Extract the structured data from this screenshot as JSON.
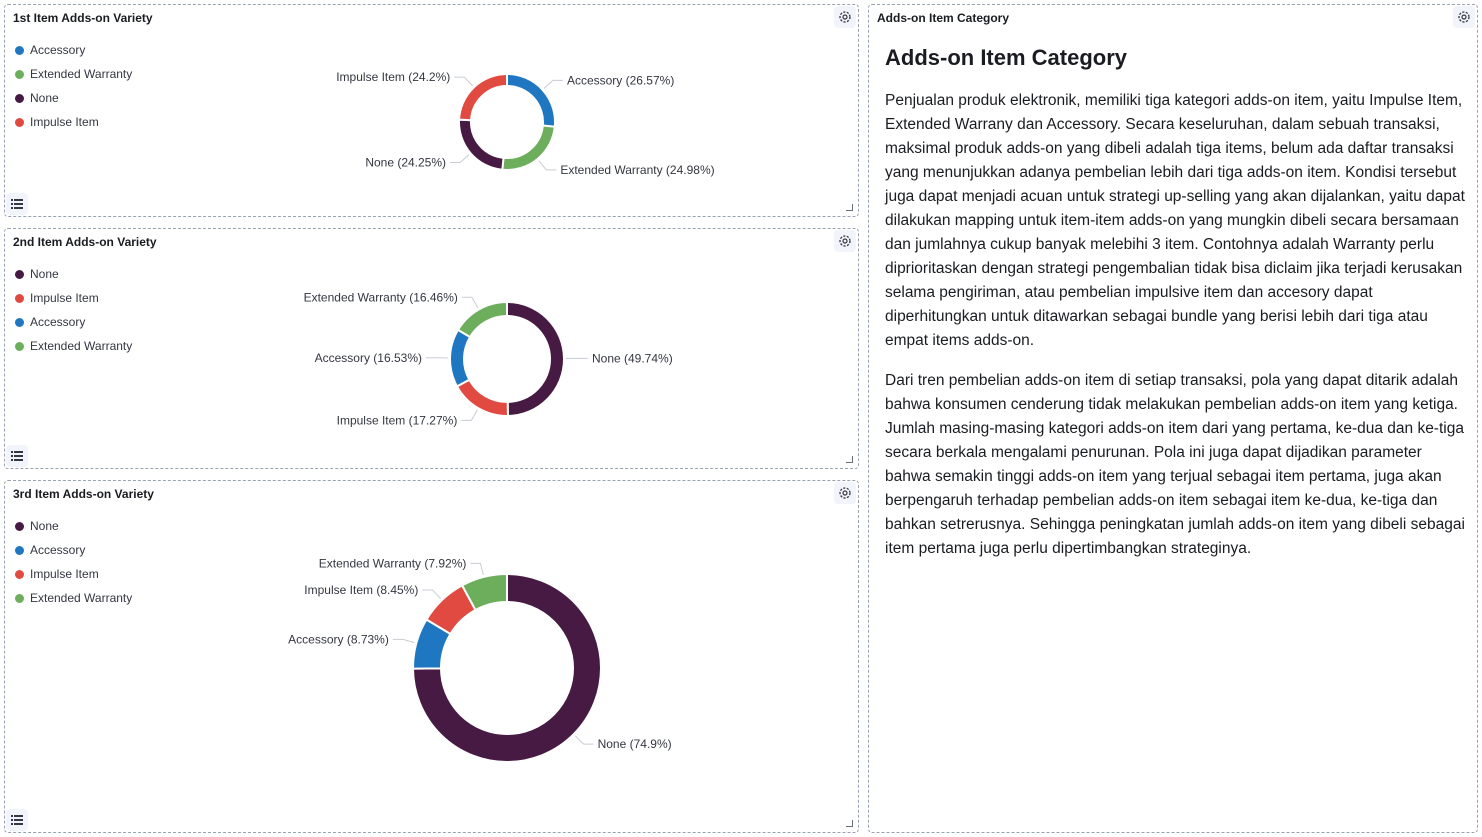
{
  "colors": {
    "Accessory": "#1f77c2",
    "Extended Warranty": "#6dae5d",
    "None": "#461a42",
    "Impulse Item": "#e04a41"
  },
  "panels": [
    {
      "title": "1st Item Adds-on Variety",
      "legend": [
        "Accessory",
        "Extended Warranty",
        "None",
        "Impulse Item"
      ]
    },
    {
      "title": "2nd Item Adds-on Variety",
      "legend": [
        "None",
        "Impulse Item",
        "Accessory",
        "Extended Warranty"
      ]
    },
    {
      "title": "3rd Item Adds-on Variety",
      "legend": [
        "None",
        "Accessory",
        "Impulse Item",
        "Extended Warranty"
      ]
    }
  ],
  "chart_data": [
    {
      "type": "pie",
      "title": "1st Item Adds-on Variety",
      "donut": true,
      "categories": [
        "Accessory",
        "Extended Warranty",
        "None",
        "Impulse Item"
      ],
      "values": [
        26.57,
        24.98,
        24.25,
        24.2
      ],
      "labels": [
        "Accessory (26.57%)",
        "Extended Warranty (24.98%)",
        "None (24.25%)",
        "Impulse Item (24.2%)"
      ]
    },
    {
      "type": "pie",
      "title": "2nd Item Adds-on Variety",
      "donut": true,
      "categories": [
        "None",
        "Impulse Item",
        "Accessory",
        "Extended Warranty"
      ],
      "values": [
        49.74,
        17.27,
        16.53,
        16.46
      ],
      "labels": [
        "None (49.74%)",
        "Impulse Item (17.27%)",
        "Accessory (16.53%)",
        "Extended Warranty (16.46%)"
      ]
    },
    {
      "type": "pie",
      "title": "3rd Item Adds-on Variety",
      "donut": true,
      "categories": [
        "None",
        "Accessory",
        "Impulse Item",
        "Extended Warranty"
      ],
      "values": [
        74.9,
        8.73,
        8.45,
        7.92
      ],
      "labels": [
        "None (74.9%)",
        "Accessory (8.73%)",
        "Impulse Item (8.45%)",
        "Extended Warranty (7.92%)"
      ]
    }
  ],
  "markdown_panel": {
    "title": "Adds-on Item Category",
    "heading": "Adds-on Item Category",
    "paragraph1": "Penjualan produk elektronik, memiliki tiga kategori adds-on item, yaitu Impulse Item, Extended Warrany dan Accessory. Secara keseluruhan, dalam sebuah transaksi, maksimal produk adds-on yang dibeli adalah tiga items, belum ada daftar transaksi yang menunjukkan adanya pembelian lebih dari tiga adds-on item. Kondisi tersebut juga dapat menjadi acuan untuk strategi up-selling yang akan dijalankan, yaitu dapat dilakukan mapping untuk item-item adds-on yang mungkin dibeli secara bersamaan dan jumlahnya cukup banyak melebihi 3 item. Contohnya adalah Warranty perlu diprioritaskan dengan strategi pengembalian tidak bisa diclaim jika terjadi kerusakan selama pengiriman, atau pembelian impulsive item dan accesory dapat diperhitungkan untuk ditawarkan sebagai bundle yang berisi lebih dari tiga atau empat items adds-on.",
    "paragraph2": "Dari tren pembelian adds-on item di setiap transaksi, pola yang dapat ditarik adalah bahwa konsumen cenderung tidak melakukan pembelian adds-on item yang ketiga. Jumlah masing-masing kategori adds-on item dari yang pertama, ke-dua dan ke-tiga secara berkala mengalami penurunan. Pola ini juga dapat dijadikan parameter bahwa semakin tinggi adds-on item yang terjual sebagai item pertama, juga akan berpengaruh terhadap pembelian adds-on item sebagai item ke-dua, ke-tiga dan bahkan setrerusnya. Sehingga peningkatan jumlah adds-on item yang dibeli sebagai item pertama juga perlu dipertimbangkan strateginya."
  },
  "icons": {
    "settings": "gear-icon",
    "legend_toggle": "list-icon",
    "resize": "resize-handle-icon"
  }
}
